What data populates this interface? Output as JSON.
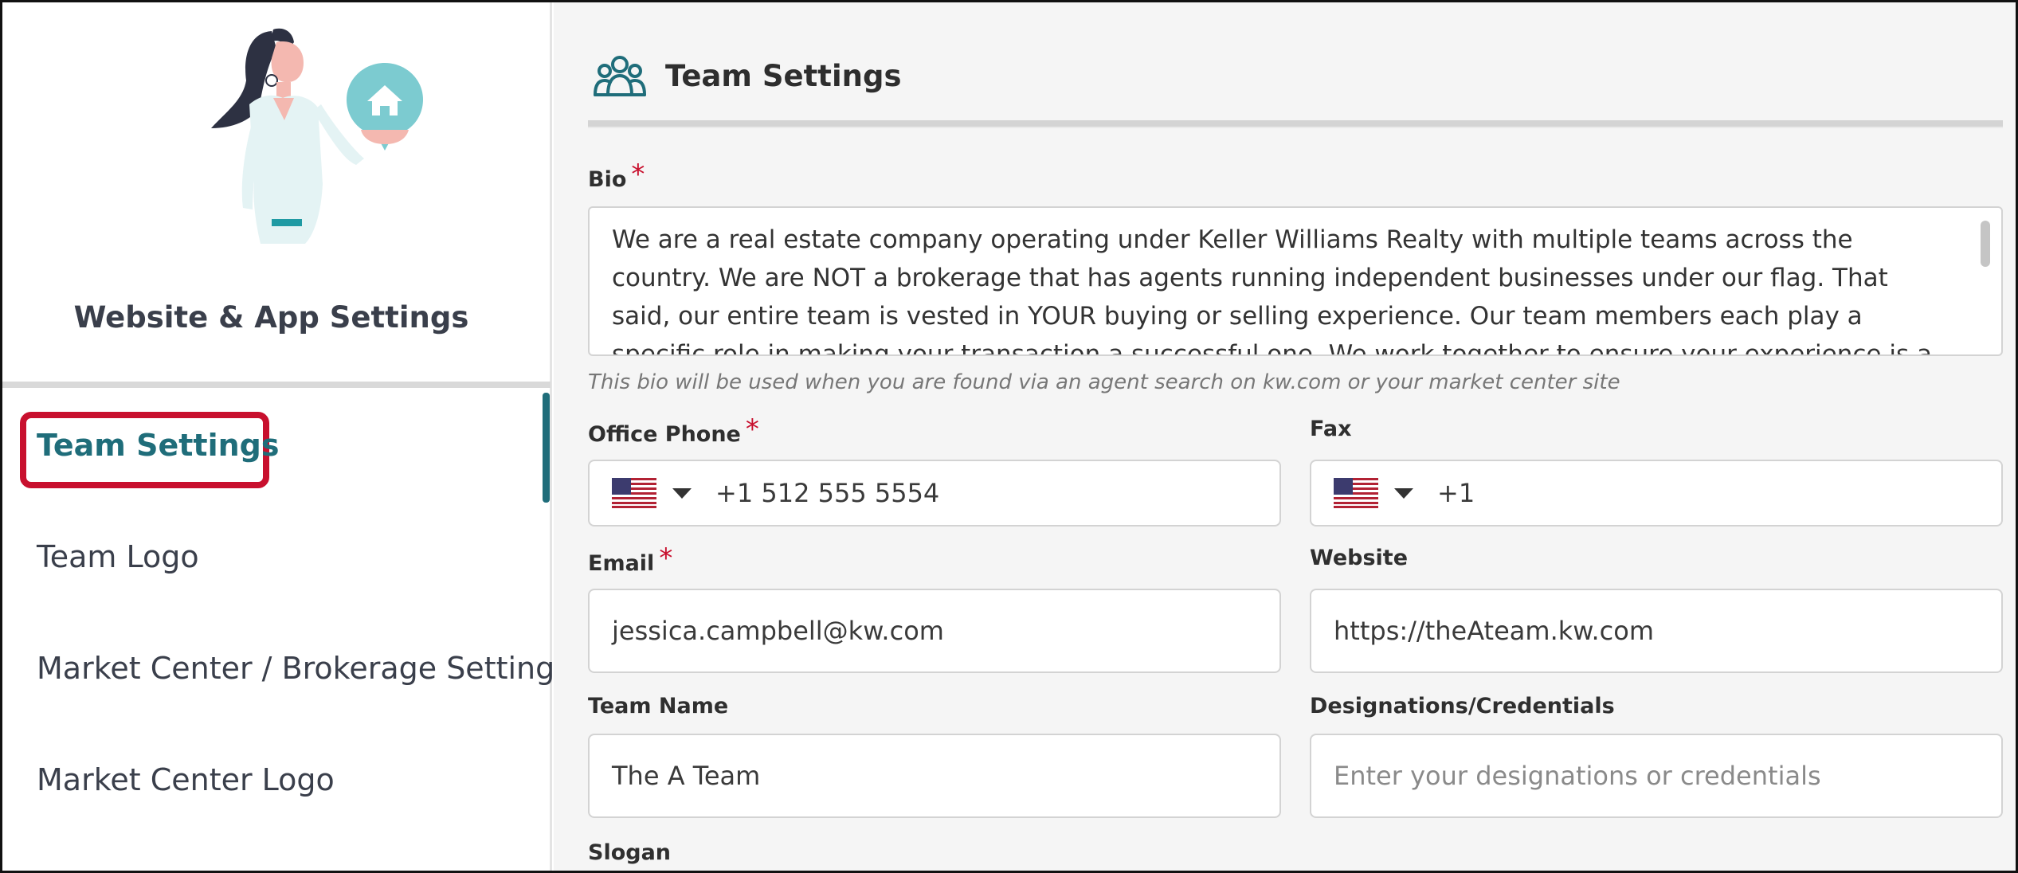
{
  "sidebar": {
    "title": "Website & App Settings",
    "items": [
      {
        "label": "Team Settings"
      },
      {
        "label": "Team Logo"
      },
      {
        "label": "Market Center / Brokerage Settings"
      },
      {
        "label": "Market Center Logo"
      }
    ]
  },
  "header": {
    "title": "Team Settings"
  },
  "form": {
    "bio": {
      "label": "Bio",
      "required": "*",
      "value": "We are a real estate company operating under Keller Williams Realty with multiple teams across the country. We are NOT a brokerage that has agents running independent businesses under our flag. That said, our entire team is vested in YOUR buying or selling experience. Our team members each play a specific role in making your transaction a successful one. We work together to ensure your experience is a great one.",
      "helper": "This bio will be used when you are found via an agent search on kw.com or your market center site"
    },
    "office_phone": {
      "label": "Office Phone",
      "required": "*",
      "value": "+1 512 555 5554"
    },
    "fax": {
      "label": "Fax",
      "value": "+1"
    },
    "email": {
      "label": "Email",
      "required": "*",
      "value": "jessica.campbell@kw.com"
    },
    "website": {
      "label": "Website",
      "value": "https://theAteam.kw.com"
    },
    "team_name": {
      "label": "Team Name",
      "value": "The A Team"
    },
    "designations": {
      "label": "Designations/Credentials",
      "placeholder": "Enter your designations or credentials"
    },
    "slogan": {
      "label": "Slogan"
    }
  },
  "colors": {
    "accent": "#1f6d7a",
    "highlight": "#c8102e",
    "required": "#c8102e",
    "icon_teal": "#7ccbd0"
  },
  "icons": {
    "header": "team-icon",
    "phone_country": "us-flag-icon",
    "dropdown": "caret-down-icon",
    "illustration_badge": "home-icon"
  }
}
